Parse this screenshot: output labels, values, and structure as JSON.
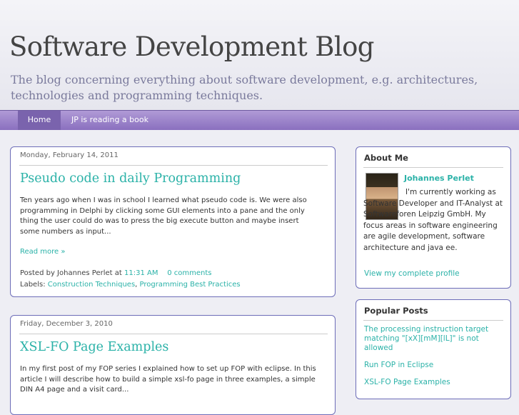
{
  "header": {
    "title": "Software Development Blog",
    "description": "The blog concerning everything about software development, e.g. architectures, technologies and programming techniques."
  },
  "nav": {
    "tabs": [
      {
        "label": "Home",
        "active": true
      },
      {
        "label": "JP is reading a book",
        "active": false
      }
    ]
  },
  "posts": [
    {
      "date": "Monday, February 14, 2011",
      "title": "Pseudo code in daily Programming",
      "excerpt": "Ten years ago when I was in school I learned what pseudo code is. We were also programming in Delphi by clicking some GUI elements into a pane and the only thing the user could do was to press the big execute button and maybe insert some numbers as input...",
      "read_more": "Read more »",
      "posted_by_prefix": "Posted by Johannes Perlet at",
      "time": "11:31 AM",
      "comments": "0 comments",
      "labels_prefix": "Labels:",
      "labels": [
        "Construction Techniques",
        "Programming Best Practices"
      ]
    },
    {
      "date": "Friday, December 3, 2010",
      "title": "XSL-FO Page Examples",
      "excerpt": "In my first post of my FOP series I explained how to set up FOP with eclipse. In this article I will describe how to build a simple xsl-fo page in three examples, a simple DIN A4 page and a visit card..."
    }
  ],
  "sidebar": {
    "about": {
      "title": "About Me",
      "name": "Johannes Perlet",
      "text": "I'm currently working as Software Developer and IT-Analyst at Softwareforen Leipzig GmbH. My focus areas in software engineering are agile development, software architecture and java ee.",
      "profile_link": "View my complete profile"
    },
    "popular": {
      "title": "Popular Posts",
      "items": [
        "The processing instruction target matching \"[xX][mM][lL]\" is not allowed",
        "Run FOP in Eclipse",
        "XSL-FO Page Examples"
      ]
    }
  },
  "colors": {
    "accent_link": "#2bb2a8",
    "nav_bar": "#9a83c9",
    "border": "#6d6db8"
  }
}
